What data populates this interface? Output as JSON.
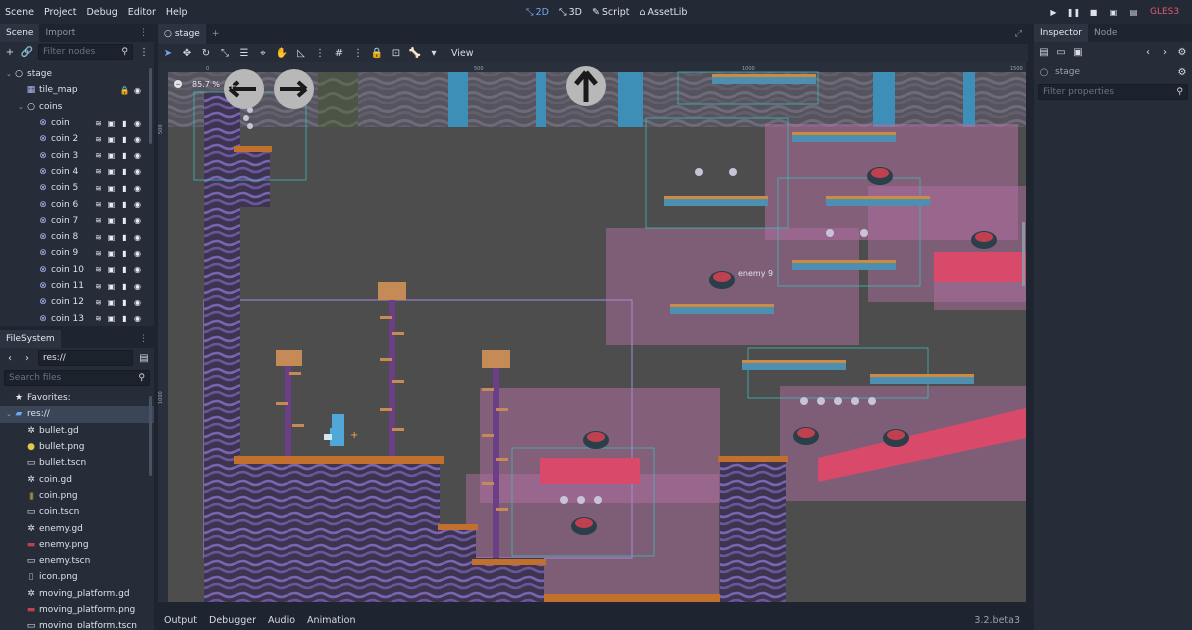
{
  "menubar": {
    "items": [
      "Scene",
      "Project",
      "Debug",
      "Editor",
      "Help"
    ]
  },
  "modes": [
    {
      "icon": "2d-icon",
      "label": "2D",
      "active": true
    },
    {
      "icon": "3d-icon",
      "label": "3D",
      "active": false
    },
    {
      "icon": "script-icon",
      "label": "Script",
      "active": false
    },
    {
      "icon": "assetlib-icon",
      "label": "AssetLib",
      "active": false
    }
  ],
  "renderer": "GLES3",
  "scene_panel": {
    "tabs": [
      "Scene",
      "Import"
    ],
    "filter_placeholder": "Filter nodes",
    "tree": [
      {
        "label": "stage",
        "depth": 0,
        "arrow": "v",
        "icon": "node2d"
      },
      {
        "label": "tile_map",
        "depth": 1,
        "arrow": "",
        "icon": "tilemap"
      },
      {
        "label": "coins",
        "depth": 1,
        "arrow": "v",
        "icon": "node2d"
      },
      {
        "label": "coin",
        "depth": 2,
        "arrow": "",
        "icon": "coin"
      },
      {
        "label": "coin 2",
        "depth": 2,
        "arrow": "",
        "icon": "coin"
      },
      {
        "label": "coin 3",
        "depth": 2,
        "arrow": "",
        "icon": "coin"
      },
      {
        "label": "coin 4",
        "depth": 2,
        "arrow": "",
        "icon": "coin"
      },
      {
        "label": "coin 5",
        "depth": 2,
        "arrow": "",
        "icon": "coin"
      },
      {
        "label": "coin 6",
        "depth": 2,
        "arrow": "",
        "icon": "coin"
      },
      {
        "label": "coin 7",
        "depth": 2,
        "arrow": "",
        "icon": "coin"
      },
      {
        "label": "coin 8",
        "depth": 2,
        "arrow": "",
        "icon": "coin"
      },
      {
        "label": "coin 9",
        "depth": 2,
        "arrow": "",
        "icon": "coin"
      },
      {
        "label": "coin 10",
        "depth": 2,
        "arrow": "",
        "icon": "coin"
      },
      {
        "label": "coin 11",
        "depth": 2,
        "arrow": "",
        "icon": "coin"
      },
      {
        "label": "coin 12",
        "depth": 2,
        "arrow": "",
        "icon": "coin"
      },
      {
        "label": "coin 13",
        "depth": 2,
        "arrow": "",
        "icon": "coin"
      }
    ]
  },
  "filesystem": {
    "tab": "FileSystem",
    "path": "res://",
    "search_placeholder": "Search files",
    "items": [
      {
        "label": "Favorites:",
        "depth": 0,
        "icon": "star",
        "arrow": ""
      },
      {
        "label": "res://",
        "depth": 0,
        "icon": "folder",
        "arrow": "v",
        "selected": true
      },
      {
        "label": "bullet.gd",
        "depth": 1,
        "icon": "gear"
      },
      {
        "label": "bullet.png",
        "depth": 1,
        "icon": "image-yellow"
      },
      {
        "label": "bullet.tscn",
        "depth": 1,
        "icon": "scene"
      },
      {
        "label": "coin.gd",
        "depth": 1,
        "icon": "gear"
      },
      {
        "label": "coin.png",
        "depth": 1,
        "icon": "image-coins"
      },
      {
        "label": "coin.tscn",
        "depth": 1,
        "icon": "scene"
      },
      {
        "label": "enemy.gd",
        "depth": 1,
        "icon": "gear"
      },
      {
        "label": "enemy.png",
        "depth": 1,
        "icon": "image-enemy"
      },
      {
        "label": "enemy.tscn",
        "depth": 1,
        "icon": "scene"
      },
      {
        "label": "icon.png",
        "depth": 1,
        "icon": "image-icon"
      },
      {
        "label": "moving_platform.gd",
        "depth": 1,
        "icon": "gear"
      },
      {
        "label": "moving_platform.png",
        "depth": 1,
        "icon": "image-platform"
      },
      {
        "label": "moving_platform.tscn",
        "depth": 1,
        "icon": "scene"
      }
    ]
  },
  "editor": {
    "scene_tab": "stage",
    "view_menu": "View",
    "zoom": "85.7 %",
    "ruler_labels": [
      "0",
      "500",
      "1000",
      "1500"
    ],
    "ruler_v_labels": [
      "500",
      "1000"
    ],
    "enemy_label": "enemy 9"
  },
  "bottom": {
    "tabs": [
      "Output",
      "Debugger",
      "Audio",
      "Animation"
    ],
    "version": "3.2.beta3"
  },
  "inspector": {
    "tabs": [
      "Inspector",
      "Node"
    ],
    "object": "stage",
    "filter_placeholder": "Filter properties"
  },
  "colors": {
    "accent": "#6fa8f0",
    "gles": "#e1596c",
    "bg": "#262d39"
  }
}
